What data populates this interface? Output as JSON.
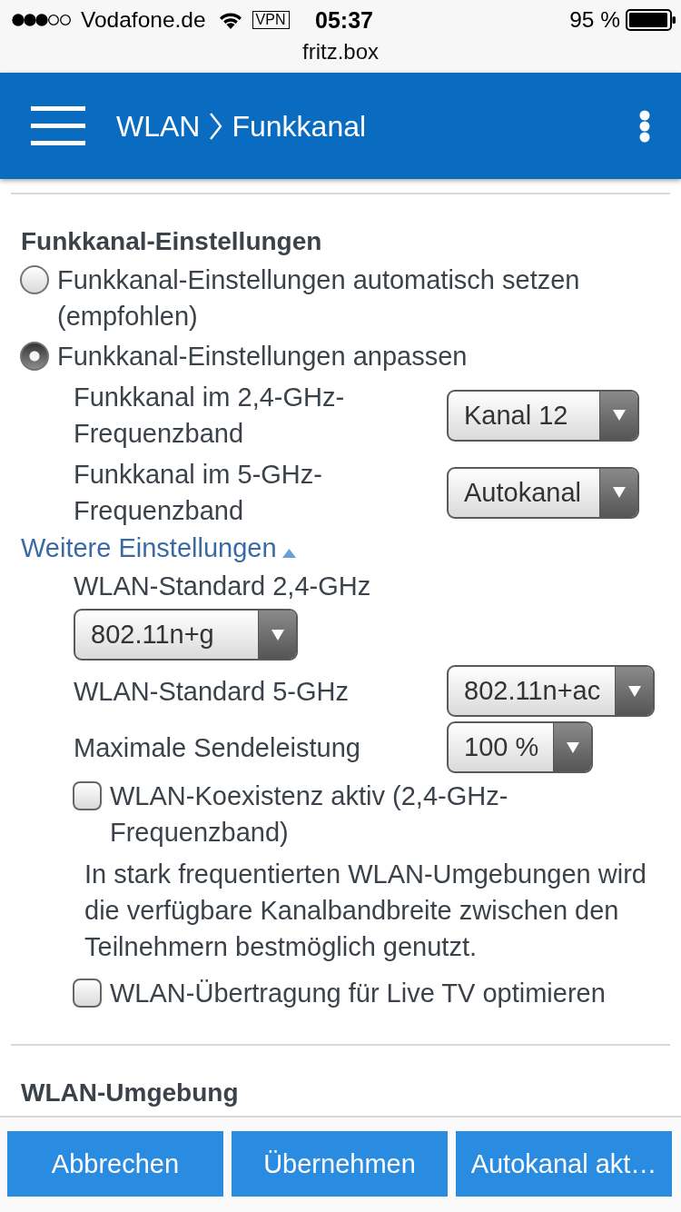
{
  "status_bar": {
    "carrier": "Vodafone.de",
    "vpn": "VPN",
    "time": "05:37",
    "battery": "95 %"
  },
  "address_bar": {
    "url": "fritz.box"
  },
  "header": {
    "breadcrumb": [
      "WLAN",
      "Funkkanal"
    ]
  },
  "channel_settings": {
    "title": "Funkkanal-Einstellungen",
    "options": [
      {
        "label": "Funkkanal-Einstellungen automatisch setzen (empfohlen)",
        "selected": false
      },
      {
        "label": "Funkkanal-Einstellungen anpassen",
        "selected": true
      }
    ],
    "channels": [
      {
        "label": "Funkkanal im 2,4-GHz-Frequenzband",
        "value": "Kanal 12"
      },
      {
        "label": "Funkkanal im 5-GHz-Frequenzband",
        "value": "Autokanal"
      }
    ]
  },
  "more_settings": {
    "link": "Weitere Einstellungen",
    "expanded": true,
    "fields": [
      {
        "kind": "stacked",
        "label": "WLAN-Standard 2,4-GHz",
        "value": "802.11n+g"
      },
      {
        "kind": "inline",
        "label": "WLAN-Standard 5-GHz",
        "value": "802.11n+ac"
      },
      {
        "kind": "inline",
        "label": "Maximale Sendeleistung",
        "value": "100 %"
      }
    ],
    "checkboxes": [
      {
        "label": "WLAN-Koexistenz aktiv (2,4-GHz-Frequenzband)",
        "checked": false,
        "description": "In stark frequentierten WLAN-Umgebungen wird die verfügbare Kanalbandbreite zwischen den Teilnehmern bestmöglich genutzt."
      },
      {
        "label": "WLAN-Übertragung für Live TV optimieren",
        "checked": false
      }
    ]
  },
  "environment": {
    "title": "WLAN-Umgebung"
  },
  "footer": {
    "buttons": [
      "Abbrechen",
      "Übernehmen",
      "Autokanal akt…"
    ]
  }
}
